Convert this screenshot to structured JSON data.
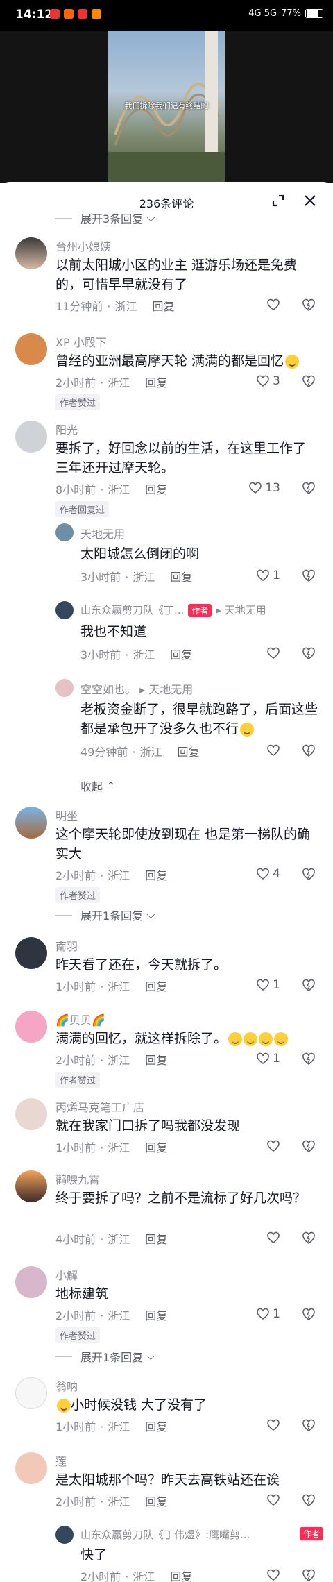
{
  "status_bar": {
    "time": "14:12",
    "signal": "4G 5G",
    "battery": "77%"
  },
  "video": {
    "caption": "我们拆除我们记有终结的"
  },
  "panel": {
    "count_label": "236条评论"
  },
  "toggles": {
    "expand3": "展开3条回复",
    "expand1": "展开1条回复",
    "collapse": "收起"
  },
  "comments": [
    {
      "name": "台州小娘姨",
      "text": "以前太阳城小区的业主 逛游乐场还是免费的，可惜早早就没有了",
      "time": "11分钟前",
      "loc": "浙江",
      "reply": "回复",
      "likes": ""
    },
    {
      "name": "XP 小殿下",
      "text": "曾经的亚洲最高摩天轮 满满的都是回忆",
      "time": "2小时前",
      "loc": "浙江",
      "reply": "回复",
      "likes": "3",
      "badge": "作者赞过"
    },
    {
      "name": "阳光",
      "text": "要拆了，好回念以前的生活，在这里工作了三年还开过摩天轮。",
      "time": "8小时前",
      "loc": "浙江",
      "reply": "回复",
      "likes": "13",
      "badge": "作者回复过"
    },
    {
      "name": "明坐",
      "text": "这个摩天轮即使放到现在 也是第一梯队的确实大",
      "time": "2小时前",
      "loc": "浙江",
      "reply": "回复",
      "likes": "4",
      "badge": "作者赞过"
    },
    {
      "name": "南羽",
      "text": "昨天看了还在，今天就拆了。",
      "time": "1小时前",
      "loc": "浙江",
      "reply": "回复",
      "likes": "1"
    },
    {
      "name": "贝贝",
      "text": "满满的回忆，就这样拆除了。",
      "time": "2小时前",
      "loc": "浙江",
      "reply": "回复",
      "likes": "1",
      "badge": "作者赞过"
    },
    {
      "name": "丙烯马克笔工广店",
      "text": "就在我家门口拆了吗我都没发现",
      "time": "1小时前",
      "loc": "浙江",
      "reply": "回复",
      "likes": ""
    },
    {
      "name": "鹳唳九霄",
      "text": "终于要拆了吗？之前不是流标了好几次吗？",
      "time": "4小时前",
      "loc": "浙江",
      "reply": "回复",
      "likes": ""
    },
    {
      "name": "小解",
      "text": "地标建筑",
      "time": "2小时前",
      "loc": "浙江",
      "reply": "回复",
      "likes": "1",
      "badge": "作者赞过"
    },
    {
      "name": "翁呐",
      "text": "小时候没钱  大了没有了",
      "time": "1小时前",
      "loc": "浙江",
      "reply": "回复",
      "likes": ""
    },
    {
      "name": "莲",
      "text": "是太阳城那个吗？昨天去高铁站还在诶",
      "time": "2小时前",
      "loc": "浙江",
      "reply": "回复",
      "likes": ""
    }
  ],
  "replies": [
    {
      "name": "天地无用",
      "text": "太阳城怎么倒闭的啊",
      "time": "3小时前",
      "loc": "浙江",
      "reply": "回复",
      "likes": "1"
    },
    {
      "name": "山东众赢剪刀队《丁...",
      "tag": "作者",
      "target": "天地无用",
      "text": "我也不知道",
      "time": "3小时前",
      "loc": "浙江",
      "reply": "回复",
      "likes": ""
    },
    {
      "name": "空空如也。",
      "target": "天地无用",
      "text": "老板资金断了，很早就跑路了，后面这些都是承包开了没多久也不行",
      "time": "49分钟前",
      "loc": "浙江",
      "reply": "回复",
      "likes": ""
    },
    {
      "name": "山东众赢剪刀队《丁伟煜》:鹰嘴剪...",
      "tag": "作者",
      "text": "快了",
      "time": "2小时前",
      "loc": "浙江",
      "reply": "回复",
      "likes": ""
    }
  ]
}
